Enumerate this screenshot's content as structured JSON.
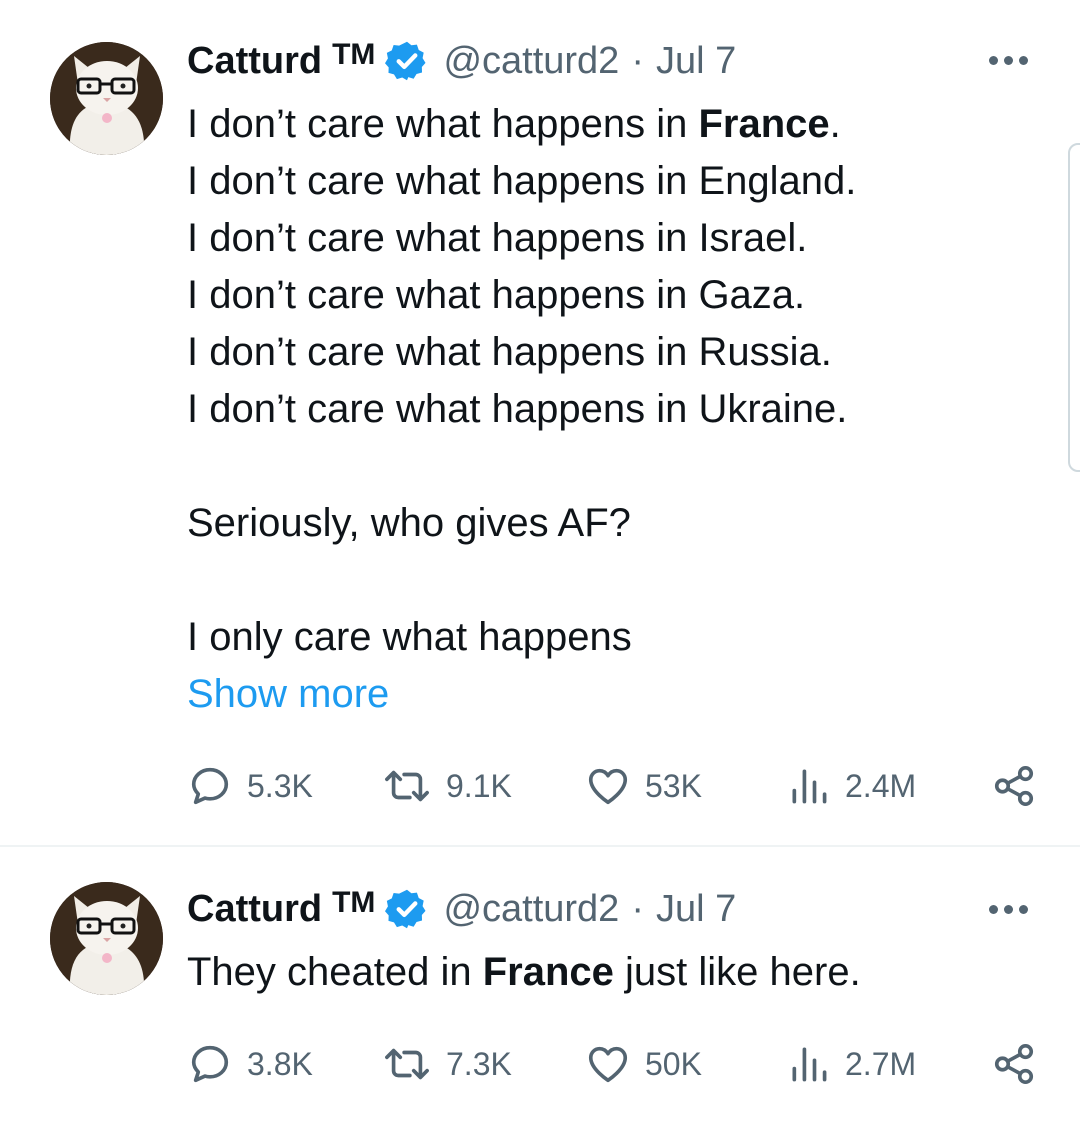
{
  "tweets": [
    {
      "author": {
        "name": "Catturd",
        "tm": "TM",
        "handle": "@catturd2",
        "separator": "·",
        "time": "Jul 7"
      },
      "lines": [
        {
          "pre": "I don’t care what happens in ",
          "bold": "France",
          "post": "."
        },
        {
          "pre": "I don’t care what happens in England.",
          "bold": "",
          "post": ""
        },
        {
          "pre": "I don’t care what happens in Israel.",
          "bold": "",
          "post": ""
        },
        {
          "pre": "I don’t care what happens in Gaza.",
          "bold": "",
          "post": ""
        },
        {
          "pre": "I don’t care what happens in Russia.",
          "bold": "",
          "post": ""
        },
        {
          "pre": "I don’t care what happens in Ukraine.",
          "bold": "",
          "post": ""
        }
      ],
      "paragraph_2": "Seriously, who gives AF?",
      "paragraph_3": "I only care what happens",
      "show_more": "Show more",
      "stats": {
        "replies": "5.3K",
        "retweets": "9.1K",
        "likes": "53K",
        "views": "2.4M"
      }
    },
    {
      "author": {
        "name": "Catturd",
        "tm": "TM",
        "handle": "@catturd2",
        "separator": "·",
        "time": "Jul 7"
      },
      "lines": [
        {
          "pre": "They cheated in ",
          "bold": "France",
          "post": " just like here."
        }
      ],
      "stats": {
        "replies": "3.8K",
        "retweets": "7.3K",
        "likes": "50K",
        "views": "2.7M"
      }
    }
  ],
  "icons": {
    "verified": "verified-badge-icon",
    "more": "more-horizontal-icon",
    "reply": "reply-icon",
    "retweet": "retweet-icon",
    "like": "heart-icon",
    "views": "views-icon",
    "share": "share-icon"
  },
  "colors": {
    "accent": "#1d9bf0",
    "text": "#0f1419",
    "muted": "#536471",
    "divider": "#eff3f4"
  }
}
